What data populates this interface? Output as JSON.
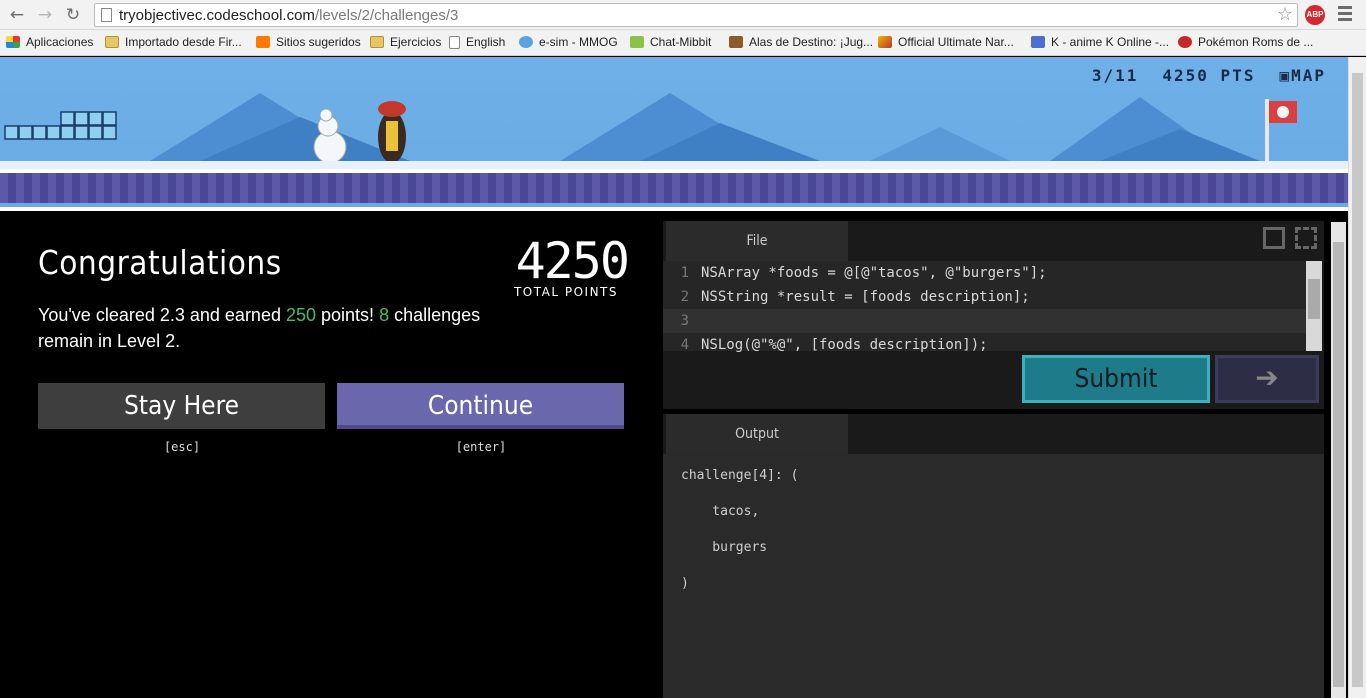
{
  "browser": {
    "url_host": "tryobjectivec.codeschool.com",
    "url_path": "/levels/2/challenges/3",
    "abp_label": "ABP"
  },
  "bookmarks": [
    {
      "label": "Aplicaciones",
      "icon": "apps-icon"
    },
    {
      "label": "Importado desde Fir...",
      "icon": "folder-icon"
    },
    {
      "label": "Sitios sugeridos",
      "icon": "orange-icon"
    },
    {
      "label": "Ejercicios",
      "icon": "folder-icon"
    },
    {
      "label": "English",
      "icon": "page-icon"
    },
    {
      "label": "e-sim - MMOG",
      "icon": "globe-icon"
    },
    {
      "label": "Chat-Mibbit",
      "icon": "mibbit-icon"
    },
    {
      "label": "Alas de Destino: ¡Jug...",
      "icon": "game-icon"
    },
    {
      "label": "Official Ultimate Nar...",
      "icon": "game-icon"
    },
    {
      "label": "K - anime K Online -...",
      "icon": "anime-icon"
    },
    {
      "label": "Pokémon Roms de ...",
      "icon": "pokemon-icon"
    }
  ],
  "game": {
    "progress": "3/11",
    "points": "4250 PTS",
    "map_label": "MAP"
  },
  "congrats": {
    "title": "Congratulations",
    "points_big": "4250",
    "points_label": "TOTAL POINTS",
    "msg_part1": "You've cleared 2.3 and earned ",
    "earned": "250",
    "msg_part2": " points! ",
    "remaining": "8",
    "msg_part3": " challenges remain in Level 2.",
    "stay_label": "Stay Here",
    "stay_hint": "[esc]",
    "continue_label": "Continue",
    "continue_hint": "[enter]"
  },
  "editor": {
    "file_tab": "File",
    "submit_label": "Submit",
    "next_label": "➔",
    "lines": [
      {
        "n": "1",
        "text": "NSArray *foods = @[@\"tacos\", @\"burgers\"];"
      },
      {
        "n": "2",
        "text": "NSString *result = [foods description];"
      },
      {
        "n": "3",
        "text": ""
      },
      {
        "n": "4",
        "text": "NSLog(@\"%@\", [foods description]);"
      }
    ]
  },
  "output": {
    "tab": "Output",
    "lines": [
      "challenge[4]: (",
      "    tacos,",
      "    burgers",
      ")"
    ]
  }
}
